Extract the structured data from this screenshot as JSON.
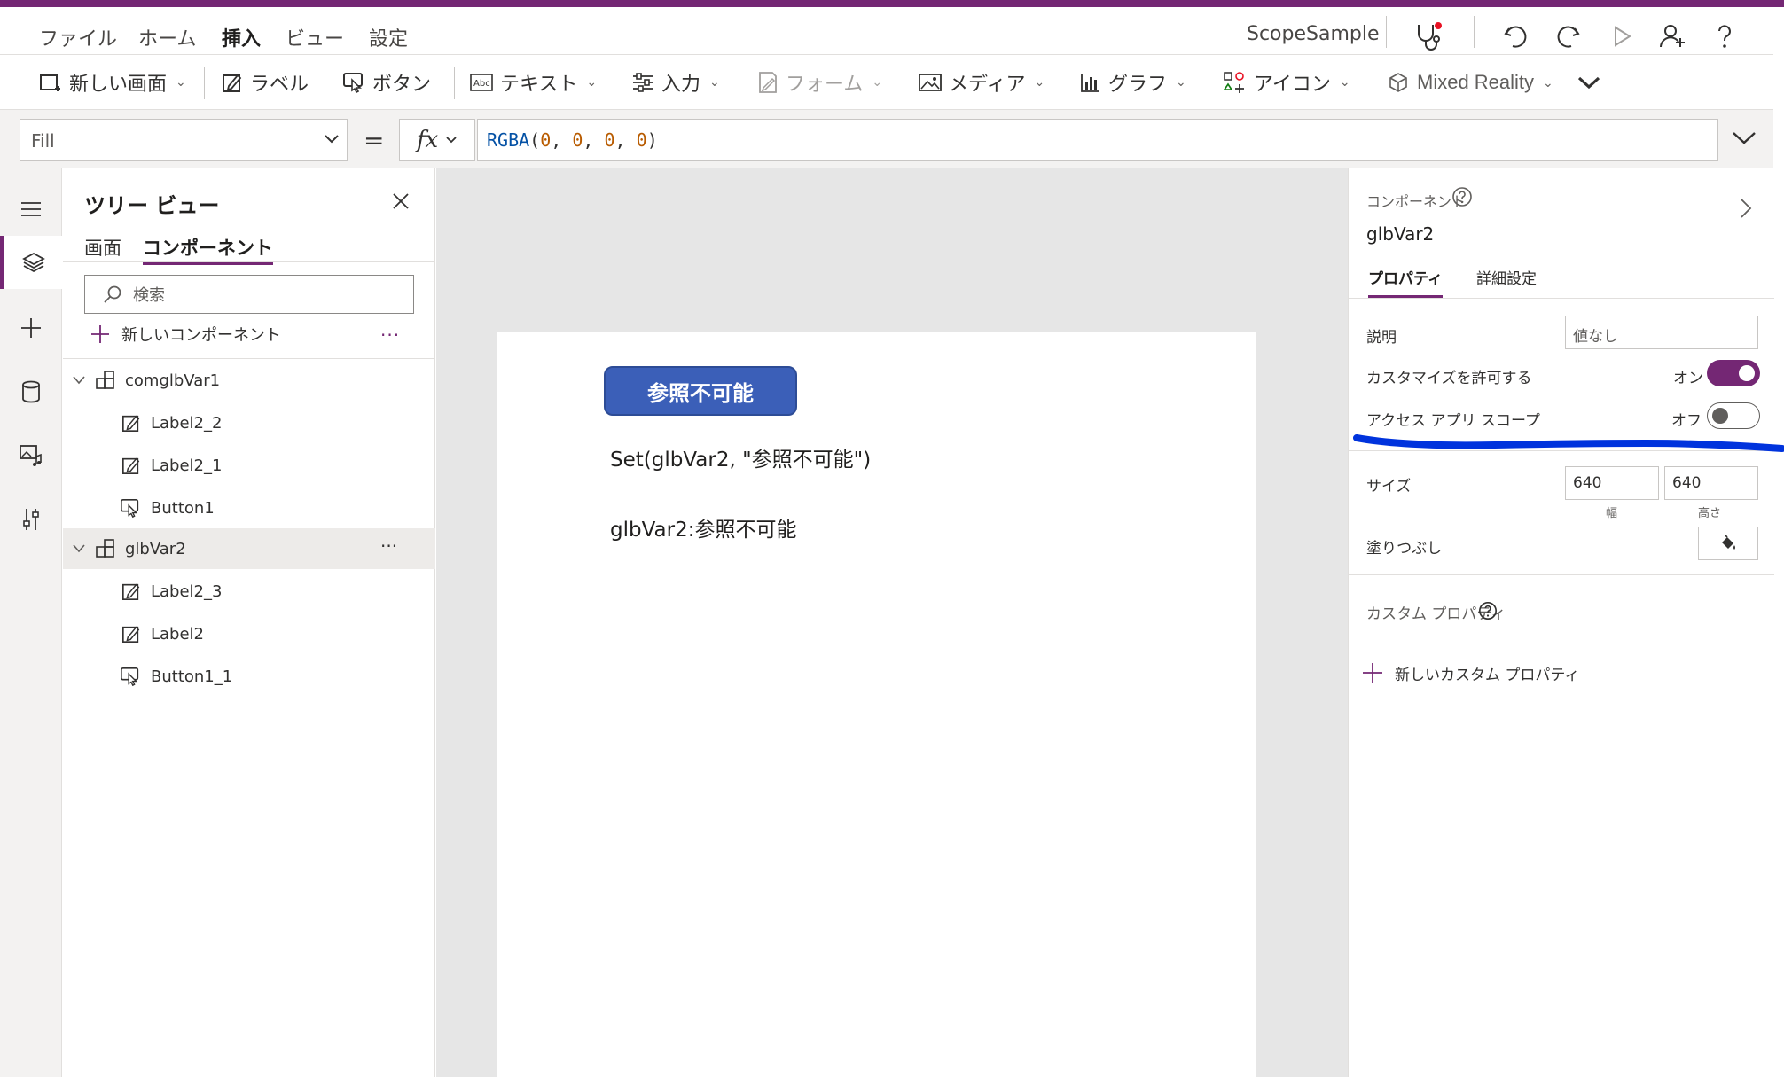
{
  "menu": {
    "items": [
      "ファイル",
      "ホーム",
      "挿入",
      "ビュー",
      "設定"
    ],
    "active": "挿入",
    "app_name": "ScopeSample"
  },
  "ribbon": {
    "new_screen": "新しい画面",
    "label": "ラベル",
    "button": "ボタン",
    "text": "テキスト",
    "input": "入力",
    "form": "フォーム",
    "media": "メディア",
    "chart": "グラフ",
    "icon": "アイコン",
    "mixed_reality": "Mixed Reality"
  },
  "formula_bar": {
    "property": "Fill",
    "equals": "=",
    "fx": "fx",
    "func": "RGBA",
    "open": "(",
    "args": [
      "0",
      "0",
      "0",
      "0"
    ],
    "sep": ", ",
    "close": ")"
  },
  "tree": {
    "title": "ツリー ビュー",
    "tab_screens": "画面",
    "tab_components": "コンポーネント",
    "search_placeholder": "検索",
    "new_component": "新しいコンポーネント",
    "more": "···",
    "items": [
      {
        "name": "comglbVar1",
        "type": "component"
      },
      {
        "name": "Label2_2",
        "type": "label"
      },
      {
        "name": "Label2_1",
        "type": "label"
      },
      {
        "name": "Button1",
        "type": "button"
      },
      {
        "name": "glbVar2",
        "type": "component"
      },
      {
        "name": "Label2_3",
        "type": "label"
      },
      {
        "name": "Label2",
        "type": "label"
      },
      {
        "name": "Button1_1",
        "type": "button"
      }
    ]
  },
  "canvas": {
    "button_text": "参照不可能",
    "label1": "Set(glbVar2, \"参照不可能\")",
    "label2": "glbVar2:参照不可能"
  },
  "props": {
    "section": "コンポーネント",
    "name": "glbVar2",
    "tab_properties": "プロパティ",
    "tab_advanced": "詳細設定",
    "description_label": "説明",
    "description_placeholder": "値なし",
    "customize_label": "カスタマイズを許可する",
    "customize_state": "オン",
    "scope_label": "アクセス アプリ スコープ",
    "scope_state": "オフ",
    "size_label": "サイズ",
    "width": "640",
    "height": "640",
    "width_caption": "幅",
    "height_caption": "高さ",
    "fill_label": "塗りつぶし",
    "custom_props_label": "カスタム プロパティ",
    "new_custom_prop": "新しいカスタム プロパティ"
  },
  "colors": {
    "brand": "#742774",
    "button_blue": "#3b5fb8",
    "annotation_blue": "#0033dd",
    "formula_func": "#0451a5",
    "formula_num": "#b85b00"
  }
}
